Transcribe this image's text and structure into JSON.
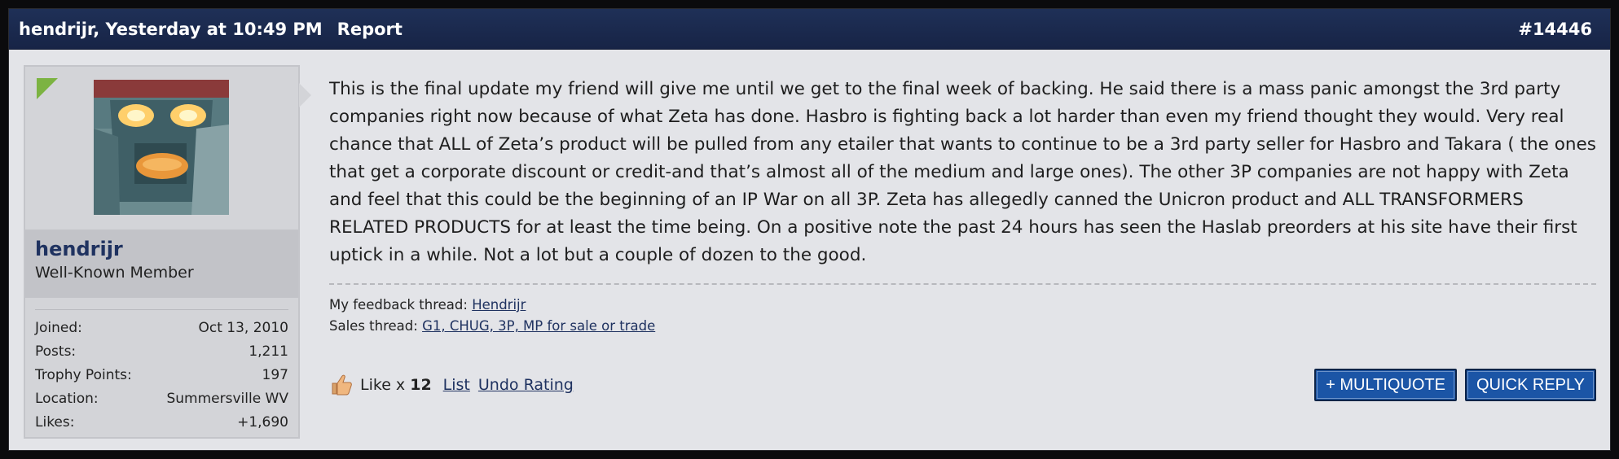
{
  "header": {
    "author_time": "hendrijr, Yesterday at 10:49 PM",
    "report": "Report",
    "post_number": "#14446"
  },
  "user": {
    "name": "hendrijr",
    "title": "Well-Known Member",
    "stats": [
      {
        "label": "Joined:",
        "value": "Oct 13, 2010"
      },
      {
        "label": "Posts:",
        "value": "1,211"
      },
      {
        "label": "Trophy Points:",
        "value": "197"
      },
      {
        "label": "Location:",
        "value": "Summersville WV"
      },
      {
        "label": "Likes:",
        "value": "+1,690"
      }
    ]
  },
  "message": "This is the final update my friend will give me until we get to the final week of backing. He said there is a mass panic amongst the 3rd party companies right now because of what Zeta has done. Hasbro is fighting back a lot harder than even my friend thought they would. Very real chance that ALL of Zeta’s product will be pulled from any etailer that wants to continue to be a 3rd party seller for Hasbro and Takara ( the ones that get a corporate discount or credit-and that’s almost all of the medium and large ones). The other 3P companies are not happy with Zeta and feel that this could be the beginning of an IP War on all 3P. Zeta has allegedly canned the Unicron product and ALL TRANSFORMERS RELATED PRODUCTS for at least the time being. On a positive note the past 24 hours has seen the Haslab preorders at his site have their first uptick in a while. Not a lot but a couple of dozen to the good.",
  "signature": {
    "feedback_label": "My feedback thread:",
    "feedback_link": "Hendrijr",
    "sales_label": "Sales thread:",
    "sales_link": "G1, CHUG, 3P, MP for sale or trade"
  },
  "footer": {
    "like_prefix": "Like x",
    "like_count": "12",
    "list_link": "List",
    "undo_link": "Undo Rating",
    "multiquote": "+ MULTIQUOTE",
    "quick_reply": "QUICK REPLY"
  },
  "icons": {
    "like": "thumbs-up-icon",
    "online": "online-indicator",
    "avatar": "avatar-robot"
  },
  "colors": {
    "header_bg": "#1f3057",
    "button_bg": "#1b55a6",
    "link": "#1f3260",
    "online": "#7cb342"
  }
}
